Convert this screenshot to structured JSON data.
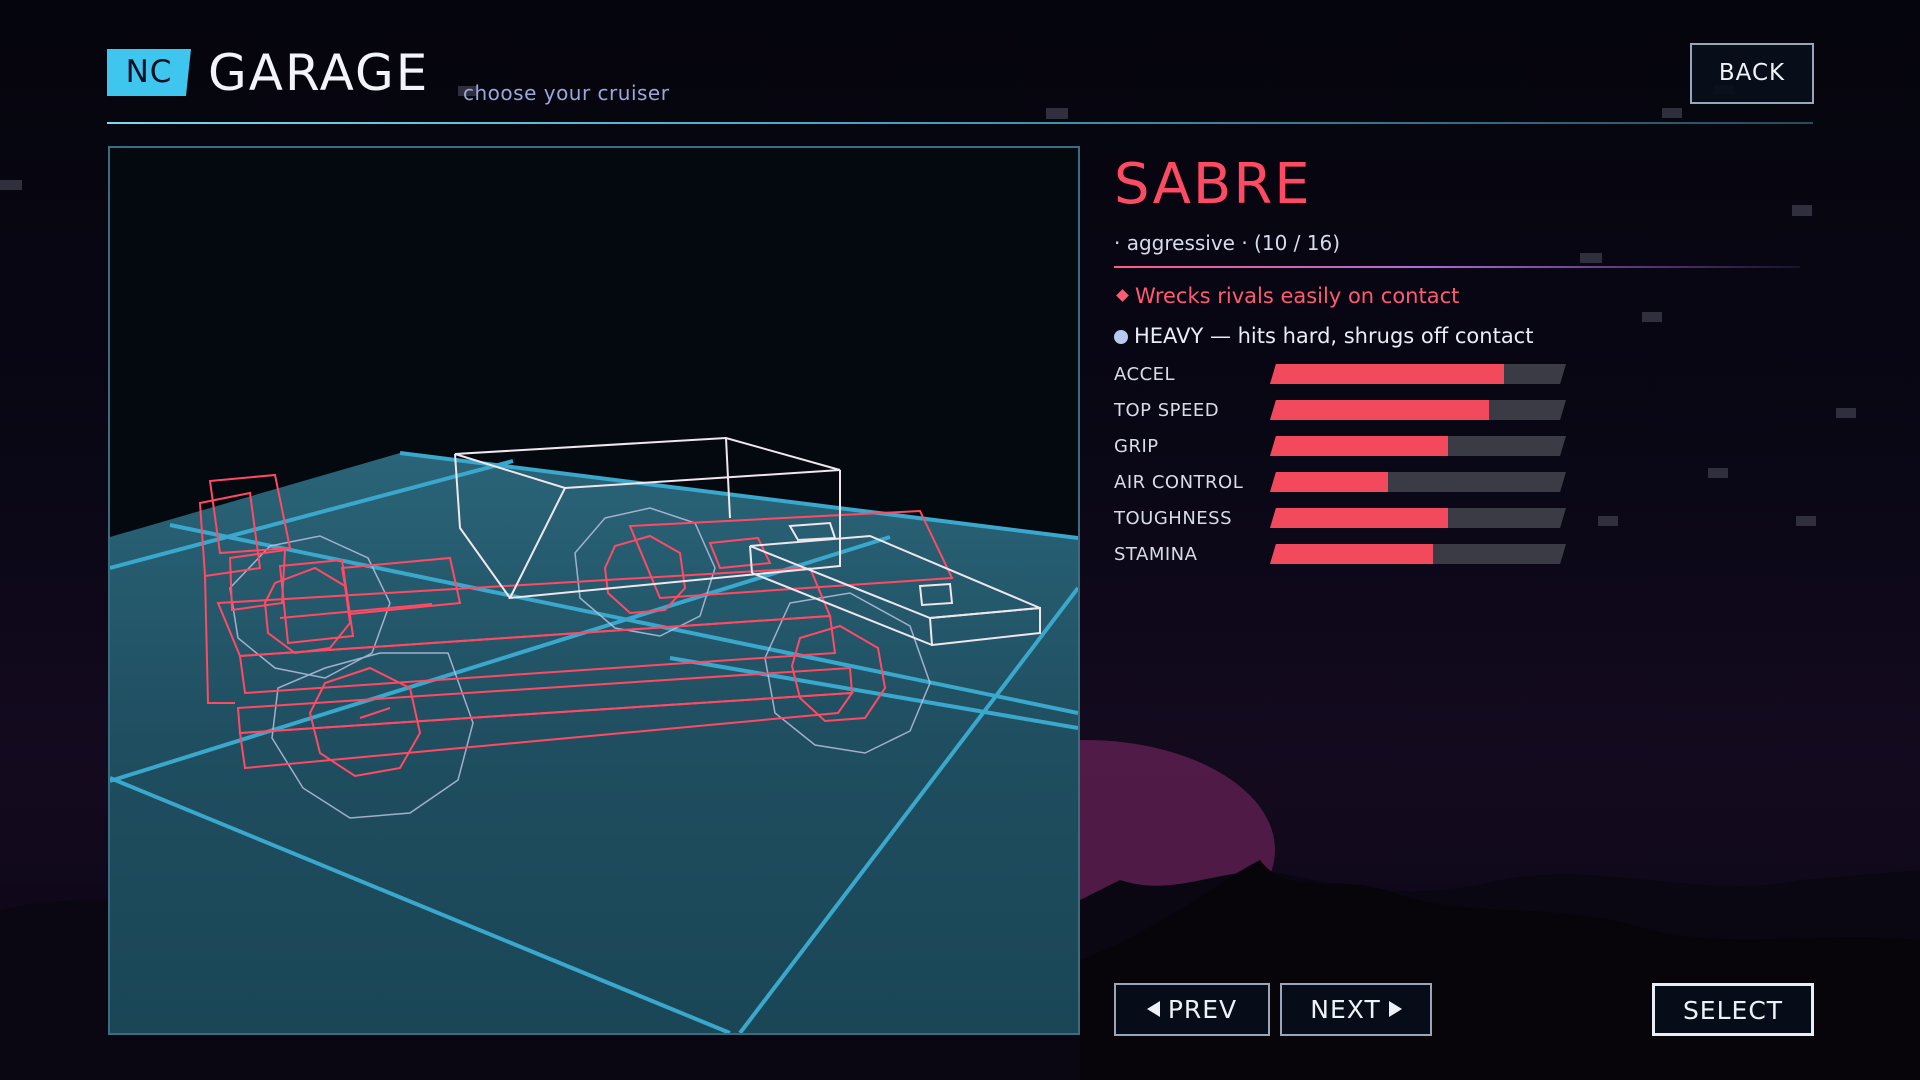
{
  "header": {
    "badge": "NC",
    "title": "GARAGE",
    "subtitle": "choose your cruiser",
    "back_label": "BACK"
  },
  "vehicle": {
    "name": "SABRE",
    "class_line": "· aggressive ·  (10 / 16)",
    "traits": [
      {
        "text": "Wrecks rivals easily on contact",
        "icon": "diamond-icon",
        "color": "#ff5a72"
      },
      {
        "text": "HEAVY — hits hard, shrugs off contact",
        "icon": "circle-icon",
        "color": "#b8c8ee"
      }
    ],
    "stats": [
      {
        "label": "ACCEL",
        "value": 0.79
      },
      {
        "label": "TOP SPEED",
        "value": 0.74
      },
      {
        "label": "GRIP",
        "value": 0.6
      },
      {
        "label": "AIR CONTROL",
        "value": 0.4
      },
      {
        "label": "TOUGHNESS",
        "value": 0.6
      },
      {
        "label": "STAMINA",
        "value": 0.55
      }
    ]
  },
  "nav": {
    "prev_label": "PREV",
    "next_label": "NEXT",
    "select_label": "SELECT"
  },
  "colors": {
    "accent_cyan": "#3fc6ee",
    "accent_red": "#f24a5c",
    "grid_floor": "#1f4d5e",
    "grid_lines": "#3aa8cc",
    "wireframe_red": "#ff4a64",
    "wireframe_white": "#e8e0ea"
  }
}
